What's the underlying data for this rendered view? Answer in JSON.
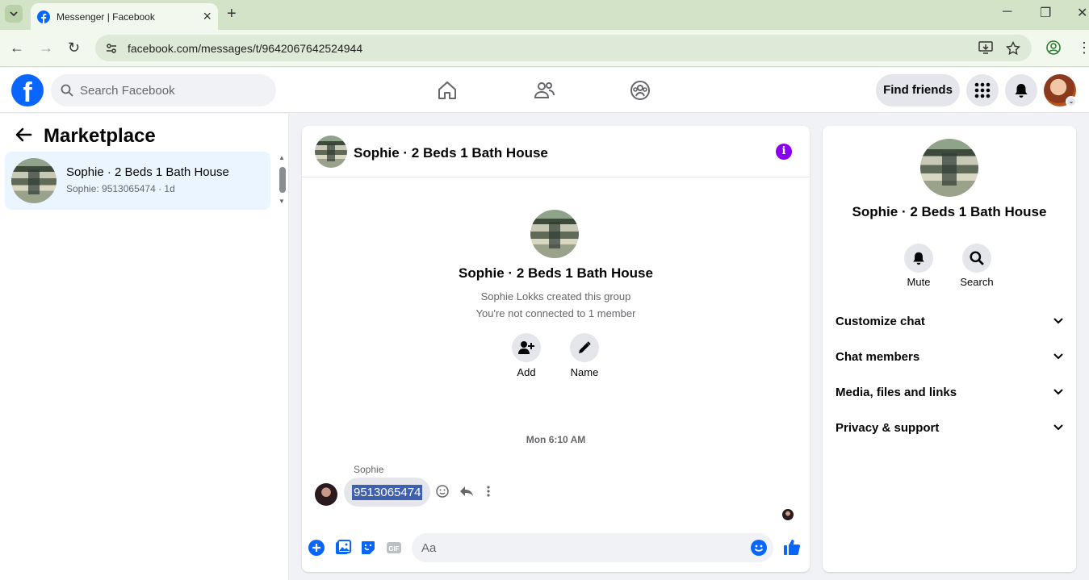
{
  "browser": {
    "tab_title": "Messenger | Facebook",
    "url": "facebook.com/messages/t/9642067642524944"
  },
  "fb_header": {
    "search_placeholder": "Search Facebook",
    "find_friends_label": "Find friends"
  },
  "left_panel": {
    "title": "Marketplace",
    "conversations": [
      {
        "name": "Sophie · 2 Beds 1 Bath House",
        "preview": "Sophie: 9513065474 · 1d"
      }
    ]
  },
  "chat": {
    "header_name": "Sophie · 2 Beds 1 Bath House",
    "group_name": "Sophie · 2 Beds 1 Bath House",
    "created_by_text": "Sophie Lokks created this group",
    "connection_text": "You're not connected to 1 member",
    "actions": [
      {
        "label": "Add",
        "icon": "add-person-icon"
      },
      {
        "label": "Name",
        "icon": "pencil-icon"
      }
    ],
    "timestamp": "Mon 6:10 AM",
    "messages": [
      {
        "sender": "Sophie",
        "text": "9513065474"
      }
    ],
    "composer_placeholder": "Aa"
  },
  "right_panel": {
    "name": "Sophie · 2 Beds 1 Bath House",
    "buttons": [
      {
        "label": "Mute",
        "icon": "bell-icon"
      },
      {
        "label": "Search",
        "icon": "search-icon"
      }
    ],
    "sections": [
      {
        "label": "Customize chat"
      },
      {
        "label": "Chat members"
      },
      {
        "label": "Media, files and links"
      },
      {
        "label": "Privacy & support"
      }
    ]
  },
  "colors": {
    "fb_blue": "#0866ff",
    "messenger_purple": "#8a00f0",
    "selected_item_bg": "#ebf5ff",
    "selection_highlight": "#3f5fb0"
  }
}
